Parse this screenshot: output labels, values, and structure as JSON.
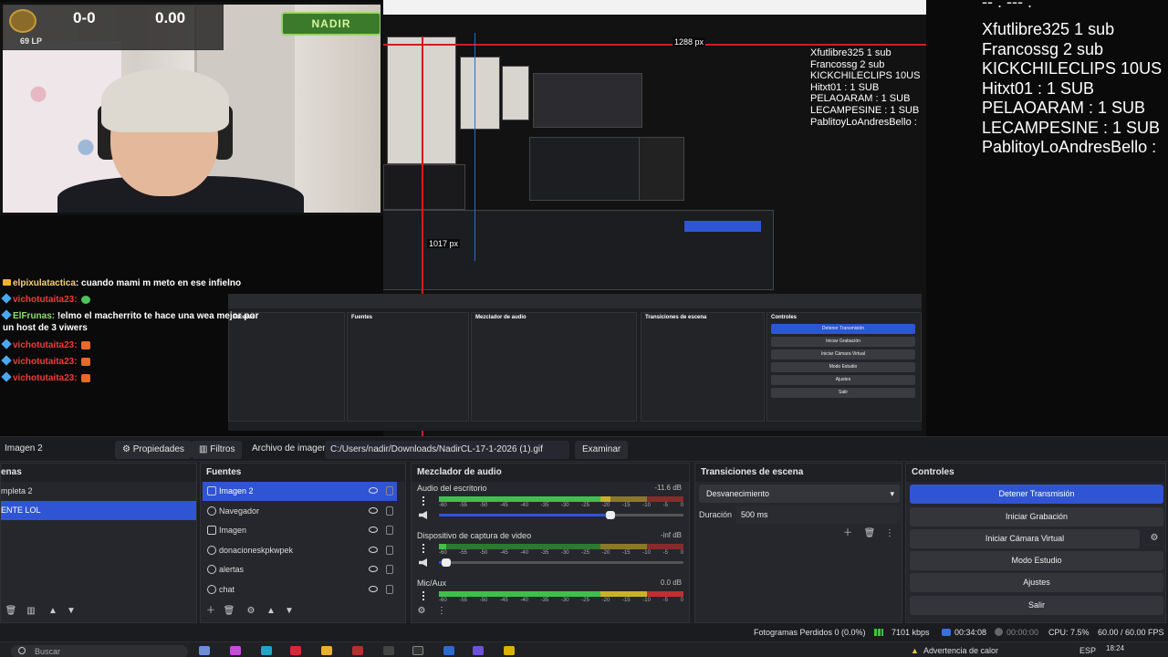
{
  "overlay": {
    "rank_lp": "69 LP",
    "score_left": "0-0",
    "score_right": "0.00",
    "logo_text": "NADIR"
  },
  "nested": {
    "width_label": "1288 px",
    "height_label": "1017 px",
    "mini_list": [
      "Xfutlibre325 1 sub",
      "Francossg 2 sub",
      "KICKCHILECLIPS 10US",
      "Hitxt01 : 1 SUB",
      "PELAOARAM : 1 SUB",
      "LECAMPESINE : 1 SUB",
      "PablitoyLoAndresBello :"
    ]
  },
  "sub_list": {
    "cut_line": "-- . --- .",
    "items": [
      "Xfutlibre325 1 sub",
      "Francossg 2 sub",
      "KICKCHILECLIPS 10US",
      "Hitxt01 : 1 SUB",
      "PELAOARAM : 1 SUB",
      "LECAMPESINE : 1 SUB",
      "PablitoyLoAndresBello :"
    ]
  },
  "chat": [
    {
      "user": "elpixulatactica",
      "text": "cuando mami m meto en ese infielno"
    },
    {
      "user": "vichotutaita23:",
      "text": ""
    },
    {
      "user": "ElFrunas:",
      "text": "!elmo el macherrito te hace una wea mejor por"
    },
    {
      "user": "",
      "text": "un host de 3 viwers"
    },
    {
      "user": "vichotutaita23:",
      "text": ""
    },
    {
      "user": "vichotutaita23:",
      "text": ""
    },
    {
      "user": "vichotutaita23:",
      "text": ""
    }
  ],
  "source_bar": {
    "selected_source": "Imagen 2",
    "properties": "Propiedades",
    "filters": "Filtros",
    "file_label": "Archivo de imagen",
    "file_path": "C:/Users/nadir/Downloads/NadirCL-17-1-2026 (1).gif",
    "browse": "Examinar"
  },
  "scenes": {
    "title": "enas",
    "items": [
      "mpleta 2",
      "ENTE LOL"
    ]
  },
  "sources": {
    "title": "Fuentes",
    "items": [
      "Imagen 2",
      "Navegador",
      "Imagen",
      "donacioneskpkwpek",
      "alertas",
      "chat"
    ]
  },
  "mixer": {
    "title": "Mezclador de audio",
    "tick_labels": [
      "-60",
      "-55",
      "-50",
      "-45",
      "-40",
      "-35",
      "-30",
      "-25",
      "-20",
      "-15",
      "-10",
      "-5",
      "0"
    ],
    "channels": [
      {
        "name": "Audio del escritorio",
        "db": "-11.6 dB",
        "level": 0.7
      },
      {
        "name": "Dispositivo de captura de video",
        "db": "-inf dB",
        "level": 0.03
      },
      {
        "name": "Mic/Aux",
        "db": "0.0 dB",
        "level": 1.0
      }
    ]
  },
  "transitions": {
    "title": "Transiciones de escena",
    "selected": "Desvanecimiento",
    "duration_label": "Duración",
    "duration_value": "500 ms"
  },
  "controls": {
    "title": "Controles",
    "buttons": [
      "Detener Transmisión",
      "Iniciar Grabación",
      "Iniciar Cámara Virtual",
      "Modo Estudio",
      "Ajustes",
      "Salir"
    ]
  },
  "status": {
    "dropped": "Fotogramas Perdidos 0 (0.0%)",
    "bitrate": "7101 kbps",
    "live_time": "00:34:08",
    "rec_time": "00:00:00",
    "cpu": "CPU: 7.5%",
    "fps": "60.00 / 60.00 FPS"
  },
  "taskbar": {
    "search_placeholder": "Buscar",
    "notice": "Advertencia de calor",
    "lang": "ESP",
    "time": "18:24"
  },
  "colors": {
    "accent": "#2f55d4",
    "meter_green": "#40c045",
    "meter_yellow": "#c8b22a",
    "meter_red": "#c03030"
  }
}
